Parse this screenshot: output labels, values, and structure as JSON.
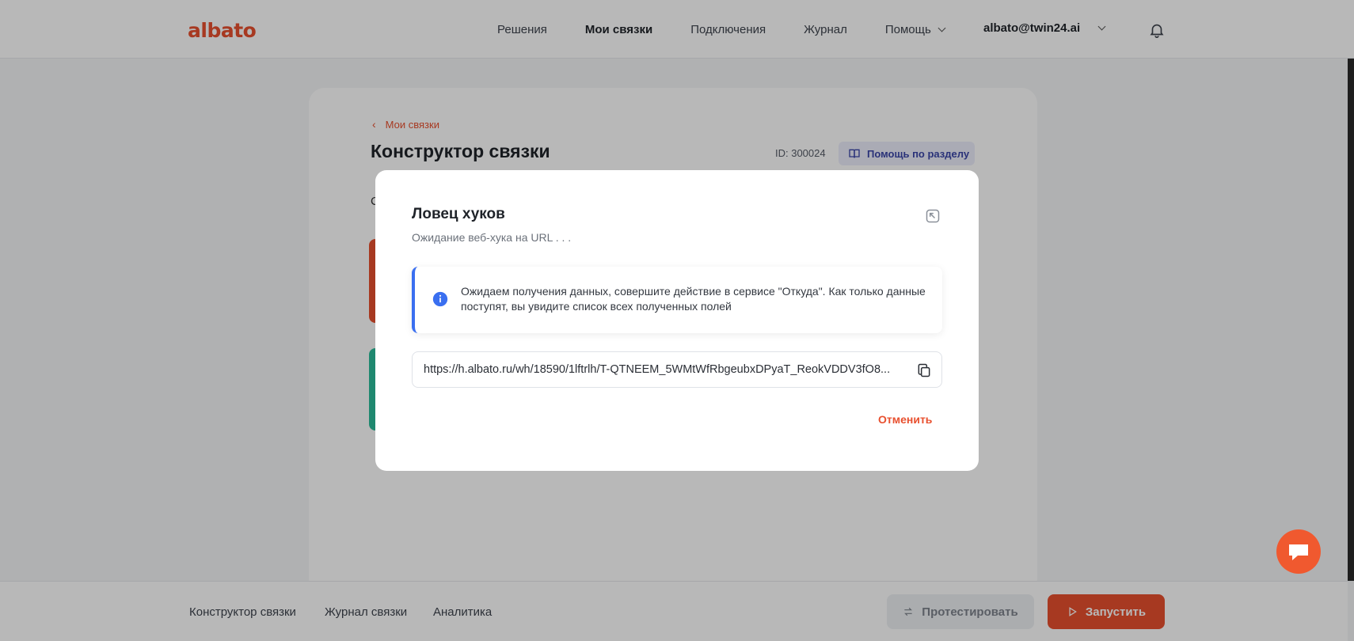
{
  "header": {
    "logo": "albato",
    "nav": [
      {
        "label": "Решения"
      },
      {
        "label": "Мои связки"
      },
      {
        "label": "Подключения"
      },
      {
        "label": "Журнал"
      },
      {
        "label": "Помощь"
      }
    ],
    "user_email": "albato@twin24.ai"
  },
  "page": {
    "back_label": "Мои связки",
    "title": "Конструктор связки",
    "id_label": "ID: 300024",
    "help_button": "Помощь по разделу",
    "partial_text": "С"
  },
  "bottom": {
    "tabs": [
      "Конструктор связки",
      "Журнал связки",
      "Аналитика"
    ],
    "test_button": "Протестировать",
    "run_button": "Запустить"
  },
  "modal": {
    "title": "Ловец хуков",
    "subtitle": "Ожидание веб-хука на URL . . .",
    "info_text": "Ожидаем получения данных, совершите действие в сервисе \"Откуда\". Как только данные поступят, вы увидите список всех полученных полей",
    "url": "https://h.albato.ru/wh/18590/1lftrlh/T-QTNEEM_5WMtWfRbgeubxDPyaT_ReokVDDV3fO8...",
    "cancel_label": "Отменить"
  },
  "colors": {
    "accent": "#e8502f",
    "info": "#3a6ff0",
    "success": "#2bbd9a"
  }
}
